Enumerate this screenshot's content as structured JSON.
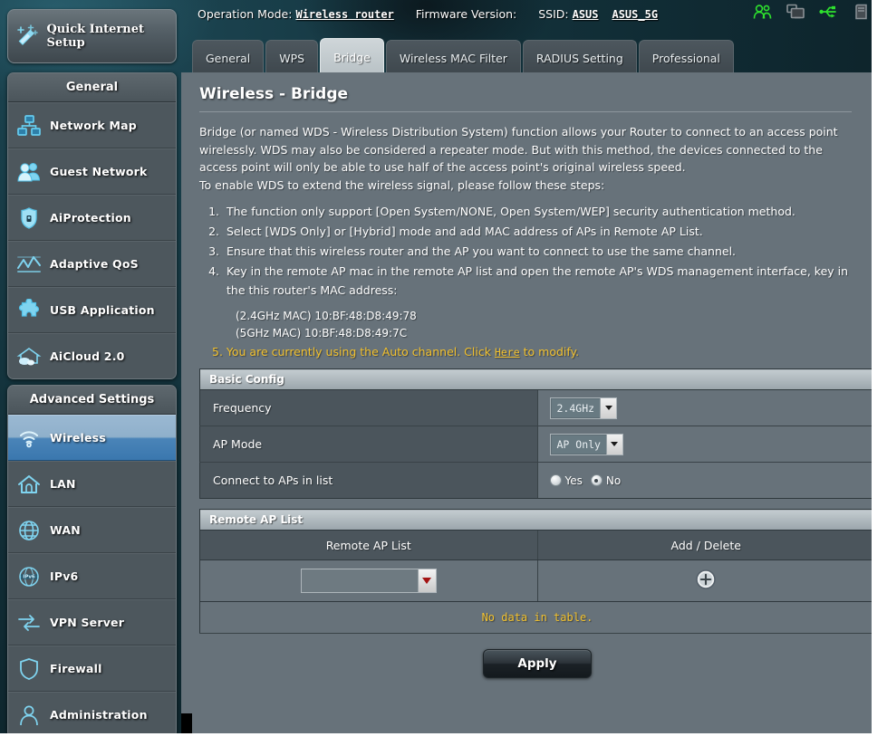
{
  "header": {
    "operation_mode_label": "Operation Mode:",
    "operation_mode_value": "Wireless router",
    "firmware_label": "Firmware Version:",
    "firmware_value": "",
    "ssid_label": "SSID:",
    "ssid_1": "ASUS",
    "ssid_2": "ASUS_5G",
    "icons": [
      {
        "name": "clients-icon",
        "color": "#33dd33"
      },
      {
        "name": "screen-icon",
        "color": "#8a9196"
      },
      {
        "name": "usb-icon",
        "color": "#33dd33"
      },
      {
        "name": "printer-icon",
        "color": "#8a9196"
      }
    ]
  },
  "quick_setup": {
    "label": "Quick Internet Setup",
    "icon": "magic-wand-icon"
  },
  "sidebar": {
    "general_header": "General",
    "general_items": [
      {
        "label": "Network Map",
        "icon": "network-map-icon"
      },
      {
        "label": "Guest Network",
        "icon": "guest-network-icon"
      },
      {
        "label": "AiProtection",
        "icon": "shield-lock-icon"
      },
      {
        "label": "Adaptive QoS",
        "icon": "qos-graph-icon"
      },
      {
        "label": "USB Application",
        "icon": "puzzle-piece-icon"
      },
      {
        "label": "AiCloud 2.0",
        "icon": "cloud-house-icon"
      }
    ],
    "advanced_header": "Advanced Settings",
    "advanced_items": [
      {
        "label": "Wireless",
        "icon": "wifi-icon",
        "active": true
      },
      {
        "label": "LAN",
        "icon": "home-icon",
        "active": false
      },
      {
        "label": "WAN",
        "icon": "globe-icon",
        "active": false
      },
      {
        "label": "IPv6",
        "icon": "ipv6-globe-icon",
        "active": false
      },
      {
        "label": "VPN Server",
        "icon": "vpn-arrows-icon",
        "active": false
      },
      {
        "label": "Firewall",
        "icon": "firewall-shield-icon",
        "active": false
      },
      {
        "label": "Administration",
        "icon": "user-admin-icon",
        "active": false
      }
    ]
  },
  "tabs": [
    {
      "label": "General",
      "active": false
    },
    {
      "label": "WPS",
      "active": false
    },
    {
      "label": "Bridge",
      "active": true
    },
    {
      "label": "Wireless MAC Filter",
      "active": false
    },
    {
      "label": "RADIUS Setting",
      "active": false
    },
    {
      "label": "Professional",
      "active": false
    }
  ],
  "page": {
    "title": "Wireless - Bridge",
    "intro_p1": "Bridge (or named WDS - Wireless Distribution System) function allows your Router to connect to an access point wirelessly. WDS may also be considered a repeater mode. But with this method, the devices connected to the access point will only be able to use half of the access point's original wireless speed.",
    "intro_p2": "To enable WDS to extend the wireless signal, please follow these steps:",
    "steps": [
      "The function only support [Open System/NONE, Open System/WEP] security authentication method.",
      "Select [WDS Only] or [Hybrid] mode and add MAC address of APs in Remote AP List.",
      "Ensure that this wireless router and the AP you want to connect to use the same channel.",
      "Key in the remote AP mac in the remote AP list and open the remote AP's WDS management interface, key in the this router's MAC address:"
    ],
    "mac_24": "(2.4GHz MAC) 10:BF:48:D8:49:78",
    "mac_5": "(5GHz MAC) 10:BF:48:D8:49:7C",
    "note_prefix": "5. You are currently using the Auto channel. Click ",
    "note_link": "Here",
    "note_suffix": " to modify."
  },
  "basic_config": {
    "section_title": "Basic Config",
    "rows": [
      {
        "label": "Frequency",
        "type": "select",
        "value": "2.4GHz"
      },
      {
        "label": "AP Mode",
        "type": "select",
        "value": "AP Only"
      },
      {
        "label": "Connect to APs in list",
        "type": "radio",
        "options": [
          {
            "label": "Yes",
            "selected": false
          },
          {
            "label": "No",
            "selected": true
          }
        ]
      }
    ]
  },
  "remote_ap": {
    "section_title": "Remote AP List",
    "col_list": "Remote AP List",
    "col_action": "Add / Delete",
    "input_value": "",
    "add_icon": "plus-circle-icon",
    "empty_message": "No data in table."
  },
  "footer": {
    "apply_label": "Apply"
  }
}
